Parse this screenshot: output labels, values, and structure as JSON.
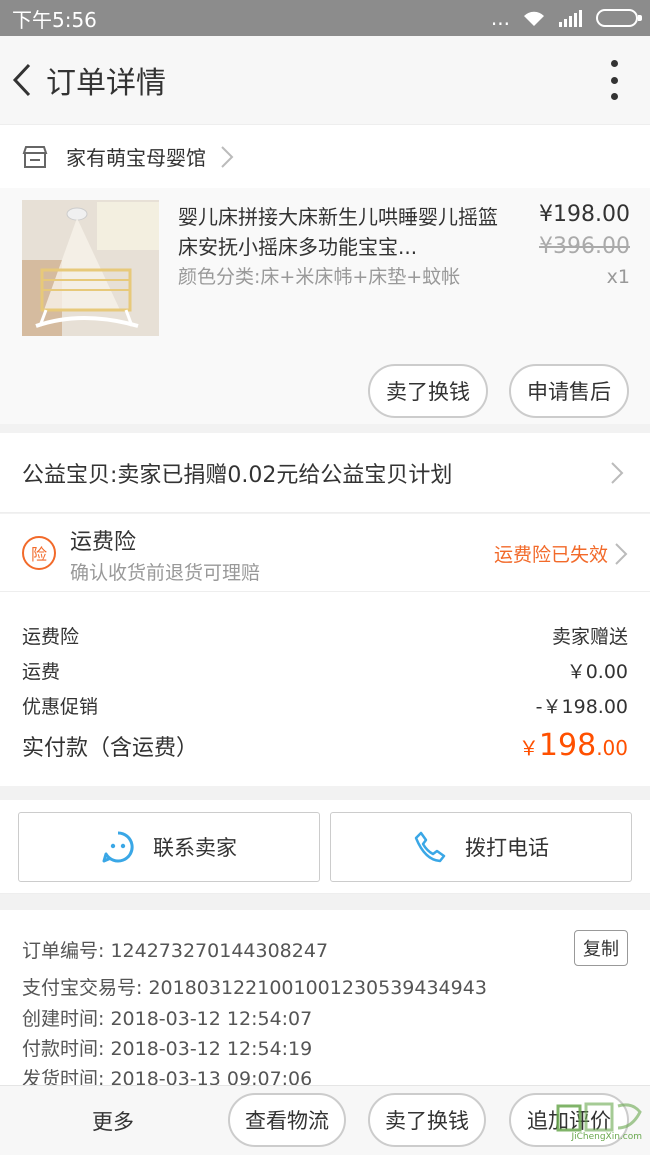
{
  "status_bar": {
    "time": "下午5:56",
    "dots": "..."
  },
  "nav": {
    "title": "订单详情"
  },
  "shop": {
    "name": "家有萌宝母婴馆"
  },
  "item": {
    "title": "婴儿床拼接大床新生儿哄睡婴儿摇篮床安抚小摇床多功能宝宝...",
    "spec": "颜色分类:床+米床帏+床垫+蚊帐",
    "price_now": "¥198.00",
    "price_orig": "¥396.00",
    "qty": "x1",
    "btn_sell": "卖了换钱",
    "btn_aftersale": "申请售后"
  },
  "charity": {
    "text": "公益宝贝:卖家已捐赠0.02元给公益宝贝计划"
  },
  "insurance": {
    "badge": "险",
    "title": "运费险",
    "subtitle": "确认收货前退货可理赔",
    "status": "运费险已失效"
  },
  "summary": {
    "rows": [
      {
        "label": "运费险",
        "value": "卖家赠送"
      },
      {
        "label": "运费",
        "value": "￥0.00"
      },
      {
        "label": "优惠促销",
        "value": "-￥198.00"
      }
    ],
    "total_label": "实付款（含运费）",
    "total_symbol": "￥",
    "total_int": "198",
    "total_dec": ".00"
  },
  "contact": {
    "seller": "联系卖家",
    "phone": "拨打电话"
  },
  "order_info": {
    "order_no": "订单编号: 124273270144308247",
    "copy": "复制",
    "alipay_no": "支付宝交易号: 2018031221001001230539434943",
    "created": "创建时间: 2018-03-12 12:54:07",
    "paid": "付款时间: 2018-03-12 12:54:19",
    "shipped": "发货时间: 2018-03-13 09:07:06"
  },
  "bottom_bar": {
    "more": "更多",
    "logistics": "查看物流",
    "sell": "卖了换钱",
    "review": "追加评价"
  },
  "watermark": {
    "text": "JiChengXin.com"
  },
  "colors": {
    "accent": "#ff5000",
    "insurance": "#f26a2a",
    "icon_blue": "#3aa7e6"
  }
}
